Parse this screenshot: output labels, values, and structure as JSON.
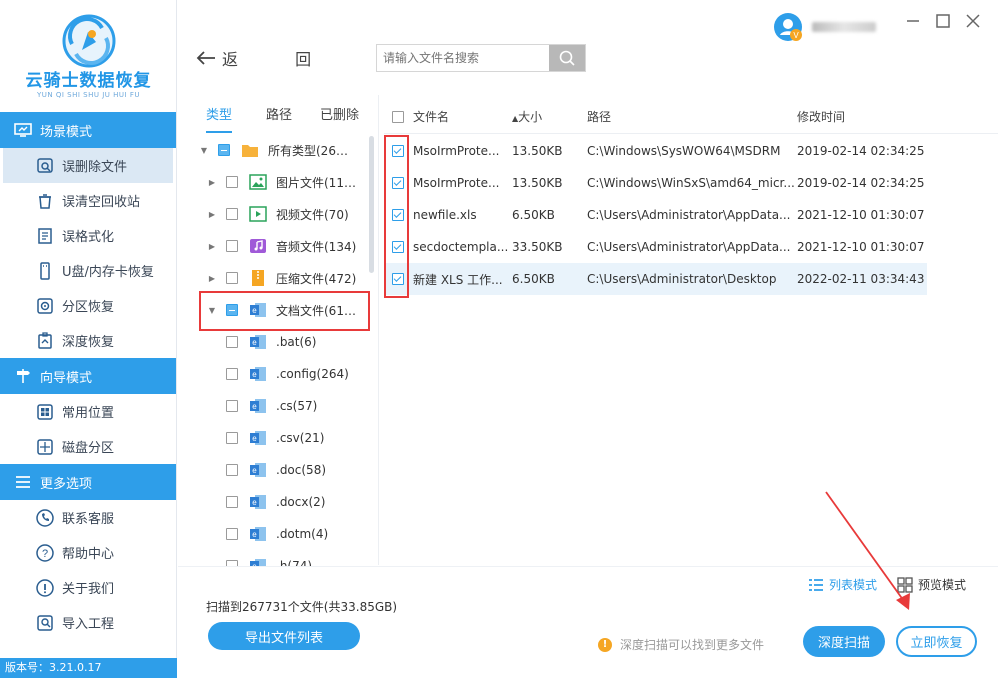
{
  "app": {
    "title": "云骑士数据恢复",
    "subtitle": "YUN QI SHI SHU JU HUI FU",
    "version": "版本号：3.21.0.17"
  },
  "sidebar": {
    "sections": [
      {
        "title": "场景模式",
        "icon": "monitor-icon",
        "items": [
          {
            "label": "误删除文件",
            "icon": "search-file-icon",
            "active": true
          },
          {
            "label": "误清空回收站",
            "icon": "recycle-bin-icon"
          },
          {
            "label": "误格式化",
            "icon": "format-icon"
          },
          {
            "label": "U盘/内存卡恢复",
            "icon": "usb-icon"
          },
          {
            "label": "分区恢复",
            "icon": "partition-icon"
          },
          {
            "label": "深度恢复",
            "icon": "deep-icon"
          }
        ]
      },
      {
        "title": "向导模式",
        "icon": "signpost-icon",
        "items": [
          {
            "label": "常用位置",
            "icon": "windows-icon"
          },
          {
            "label": "磁盘分区",
            "icon": "disk-icon"
          }
        ]
      },
      {
        "title": "更多选项",
        "icon": "menu-icon",
        "items": [
          {
            "label": "联系客服",
            "icon": "phone-icon"
          },
          {
            "label": "帮助中心",
            "icon": "help-icon"
          },
          {
            "label": "关于我们",
            "icon": "info-icon"
          },
          {
            "label": "导入工程",
            "icon": "import-icon"
          }
        ]
      }
    ]
  },
  "header": {
    "back_label": "返 回",
    "search_placeholder": "请输入文件名搜索",
    "user_badge": "V"
  },
  "tabs": [
    "类型",
    "路径",
    "已删除"
  ],
  "tree": [
    {
      "label": "所有类型(2677...",
      "level": 0,
      "arrow": "down",
      "state": "partial",
      "icon": "folder-icon"
    },
    {
      "label": "图片文件(118...",
      "level": 1,
      "arrow": "right",
      "state": "none",
      "icon": "image-file-icon"
    },
    {
      "label": "视频文件(70)",
      "level": 1,
      "arrow": "right",
      "state": "none",
      "icon": "video-file-icon"
    },
    {
      "label": "音频文件(134)",
      "level": 1,
      "arrow": "right",
      "state": "none",
      "icon": "audio-file-icon"
    },
    {
      "label": "压缩文件(472)",
      "level": 1,
      "arrow": "right",
      "state": "none",
      "icon": "zip-file-icon"
    },
    {
      "label": "文档文件(617...",
      "level": 1,
      "arrow": "down",
      "state": "partial",
      "icon": "doc-file-icon"
    },
    {
      "label": ".bat(6)",
      "level": 2,
      "arrow": "",
      "state": "none",
      "icon": "doc-file-icon"
    },
    {
      "label": ".config(264)",
      "level": 2,
      "arrow": "",
      "state": "none",
      "icon": "doc-file-icon"
    },
    {
      "label": ".cs(57)",
      "level": 2,
      "arrow": "",
      "state": "none",
      "icon": "doc-file-icon"
    },
    {
      "label": ".csv(21)",
      "level": 2,
      "arrow": "",
      "state": "none",
      "icon": "doc-file-icon"
    },
    {
      "label": ".doc(58)",
      "level": 2,
      "arrow": "",
      "state": "none",
      "icon": "doc-file-icon"
    },
    {
      "label": ".docx(2)",
      "level": 2,
      "arrow": "",
      "state": "none",
      "icon": "doc-file-icon"
    },
    {
      "label": ".dotm(4)",
      "level": 2,
      "arrow": "",
      "state": "none",
      "icon": "doc-file-icon"
    },
    {
      "label": ".h(74)",
      "level": 2,
      "arrow": "",
      "state": "none",
      "icon": "doc-file-icon"
    }
  ],
  "file_list": {
    "columns": {
      "name": "文件名",
      "size": "大小",
      "path": "路径",
      "modified": "修改时间"
    },
    "sort_indicator": "▲",
    "rows": [
      {
        "name": "MsoIrmProte...",
        "size": "13.50KB",
        "path": "C:\\Windows\\SysWOW64\\MSDRM",
        "modified": "2019-02-14 02:34:25",
        "checked": true
      },
      {
        "name": "MsoIrmProte...",
        "size": "13.50KB",
        "path": "C:\\Windows\\WinSxS\\amd64_micr...",
        "modified": "2019-02-14 02:34:25",
        "checked": true
      },
      {
        "name": "newfile.xls",
        "size": "6.50KB",
        "path": "C:\\Users\\Administrator\\AppData...",
        "modified": "2021-12-10 01:30:07",
        "checked": true
      },
      {
        "name": "secdoctempla...",
        "size": "33.50KB",
        "path": "C:\\Users\\Administrator\\AppData...",
        "modified": "2021-12-10 01:30:07",
        "checked": true
      },
      {
        "name": "新建 XLS 工作...",
        "size": "6.50KB",
        "path": "C:\\Users\\Administrator\\Desktop",
        "modified": "2022-02-11 03:34:43",
        "checked": true,
        "selected": true
      }
    ]
  },
  "footer": {
    "summary": "扫描到267731个文件(共33.85GB)",
    "export_label": "导出文件列表",
    "list_mode": "列表模式",
    "preview_mode": "预览模式",
    "tip": "深度扫描可以找到更多文件",
    "deep_scan": "深度扫描",
    "recover_now": "立即恢复"
  },
  "colors": {
    "accent": "#2e9ee9",
    "highlight": "#e83a3a",
    "warning": "#f5a623"
  }
}
